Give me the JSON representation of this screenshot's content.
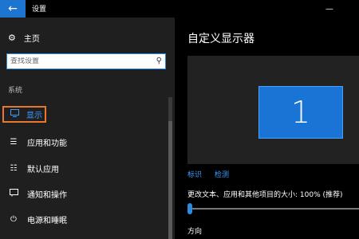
{
  "window": {
    "title": "设置",
    "back_icon": "back-arrow-icon",
    "minimize_icon": "minimize-icon"
  },
  "sidebar": {
    "home": {
      "label": "主页",
      "icon": "gear-icon"
    },
    "search": {
      "placeholder": "查找设置",
      "icon": "search-icon"
    },
    "section_label": "系统",
    "items": [
      {
        "label": "显示",
        "icon": "monitor-icon",
        "active": true
      },
      {
        "label": "应用和功能",
        "icon": "apps-list-icon"
      },
      {
        "label": "默认应用",
        "icon": "default-apps-icon"
      },
      {
        "label": "通知和操作",
        "icon": "notification-icon"
      },
      {
        "label": "电源和睡眠",
        "icon": "power-icon"
      }
    ]
  },
  "main": {
    "title": "自定义显示器",
    "monitor_number": "1",
    "links": {
      "identify": "标识",
      "detect": "检测"
    },
    "scale_label": "更改文本、应用和其他项目的大小: 100% (推荐)",
    "scale_percent": 100,
    "orientation_label": "方向"
  },
  "colors": {
    "accent": "#1e75d0",
    "link": "#3c9bff",
    "highlight_border": "#e8782f",
    "sidebar_bg": "#1f1f1f",
    "content_bg": "#000000"
  }
}
